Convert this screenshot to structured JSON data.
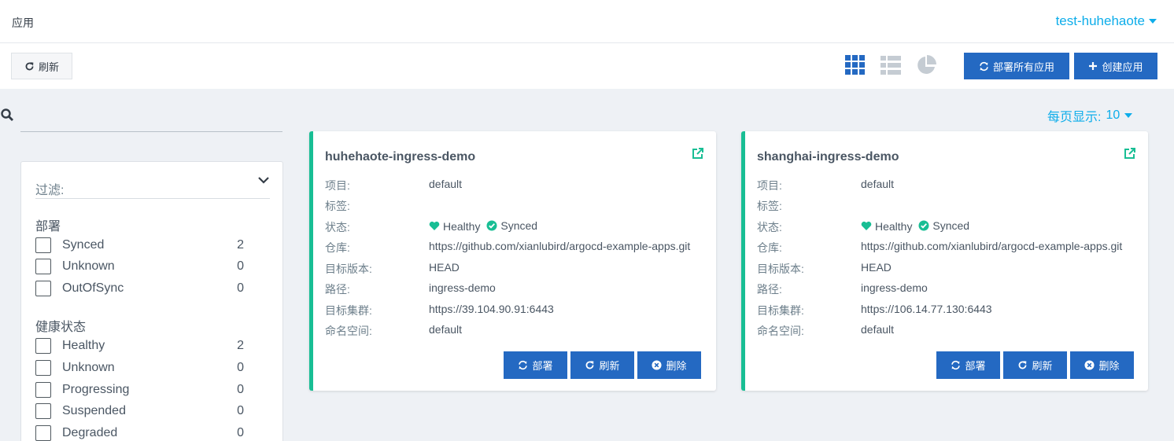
{
  "topbar": {
    "title": "应用",
    "user": "test-huhehaote"
  },
  "toolbar": {
    "refresh": "刷新",
    "sync_all": "部署所有应用",
    "create": "创建应用"
  },
  "icons": {
    "grid": "tiles-icon",
    "list": "list-icon",
    "summary": "pie-chart-icon"
  },
  "search": {
    "placeholder": ""
  },
  "per_page": {
    "label": "每页显示:",
    "value": "10"
  },
  "filter": {
    "title": "过滤:",
    "groups": [
      {
        "title": "部署",
        "items": [
          {
            "label": "Synced",
            "count": "2"
          },
          {
            "label": "Unknown",
            "count": "0"
          },
          {
            "label": "OutOfSync",
            "count": "0"
          }
        ]
      },
      {
        "title": "健康状态",
        "items": [
          {
            "label": "Healthy",
            "count": "2"
          },
          {
            "label": "Unknown",
            "count": "0"
          },
          {
            "label": "Progressing",
            "count": "0"
          },
          {
            "label": "Suspended",
            "count": "0"
          },
          {
            "label": "Degraded",
            "count": "0"
          }
        ]
      }
    ]
  },
  "labels": {
    "project": "项目:",
    "tags": "标签:",
    "status": "状态:",
    "repo": "仓库:",
    "target_rev": "目标版本:",
    "path": "路径:",
    "cluster": "目标集群:",
    "namespace": "命名空间:"
  },
  "card_buttons": {
    "sync": "部署",
    "refresh": "刷新",
    "delete": "删除"
  },
  "apps": [
    {
      "name": "huhehaote-ingress-demo",
      "project": "default",
      "tags": "",
      "health": "Healthy",
      "sync": "Synced",
      "repo": "https://github.com/xianlubird/argocd-example-apps.git",
      "target_rev": "HEAD",
      "path": "ingress-demo",
      "cluster": "https://39.104.90.91:6443",
      "namespace": "default"
    },
    {
      "name": "shanghai-ingress-demo",
      "project": "default",
      "tags": "",
      "health": "Healthy",
      "sync": "Synced",
      "repo": "https://github.com/xianlubird/argocd-example-apps.git",
      "target_rev": "HEAD",
      "path": "ingress-demo",
      "cluster": "https://106.14.77.130:6443",
      "namespace": "default"
    }
  ],
  "colors": {
    "accent": "#0dadea",
    "primary": "#2469c2",
    "healthy": "#18be94"
  }
}
